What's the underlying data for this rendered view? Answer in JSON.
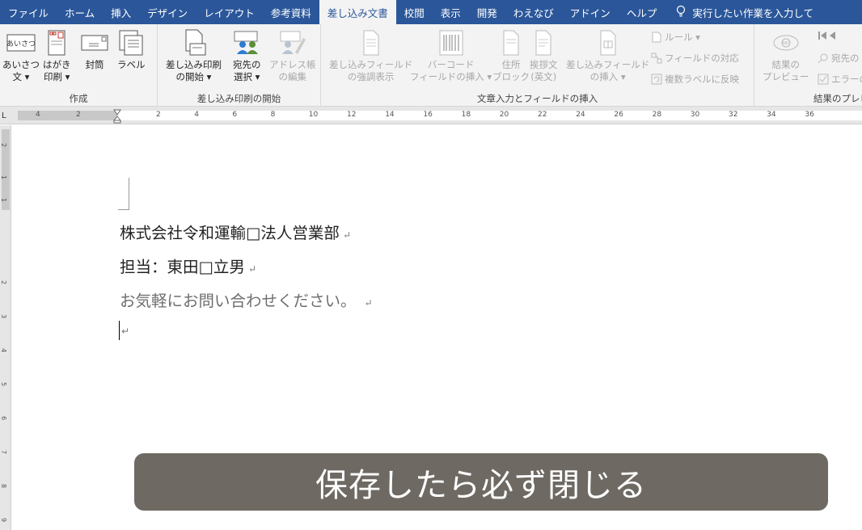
{
  "tabs": [
    {
      "label": "ファイル",
      "active": false
    },
    {
      "label": "ホーム",
      "active": false
    },
    {
      "label": "挿入",
      "active": false
    },
    {
      "label": "デザイン",
      "active": false
    },
    {
      "label": "レイアウト",
      "active": false
    },
    {
      "label": "参考資料",
      "active": false
    },
    {
      "label": "差し込み文書",
      "active": true
    },
    {
      "label": "校閲",
      "active": false
    },
    {
      "label": "表示",
      "active": false
    },
    {
      "label": "開発",
      "active": false
    },
    {
      "label": "わえなび",
      "active": false
    },
    {
      "label": "アドイン",
      "active": false
    },
    {
      "label": "ヘルプ",
      "active": false
    }
  ],
  "tell_me": "実行したい作業を入力して",
  "ribbon": {
    "create": {
      "label": "作成",
      "greeting_line1": "あいさつ",
      "greeting_line2": "文 ▾",
      "postcard_line1": "はがき",
      "postcard_line2": "印刷 ▾",
      "envelope": "封筒",
      "label_btn": "ラベル",
      "greeting_icon_text": "あいさつ"
    },
    "start_merge": {
      "label": "差し込み印刷の開始",
      "start_line1": "差し込み印刷",
      "start_line2": "の開始 ▾",
      "select_line1": "宛先の",
      "select_line2": "選択 ▾",
      "edit_line1": "アドレス帳",
      "edit_line2": "の編集"
    },
    "write_insert": {
      "label": "文章入力とフィールドの挿入",
      "highlight_line1": "差し込みフィールド",
      "highlight_line2": "の強調表示",
      "barcode_line1": "バーコード",
      "barcode_line2": "フィールドの挿入 ▾",
      "address_line1": "住所",
      "address_line2": "ブロック",
      "greeting_en_line1": "挨拶文",
      "greeting_en_line2": "(英文)",
      "insert_field_line1": "差し込みフィールド",
      "insert_field_line2": "の挿入 ▾",
      "rules": "ルール ▾",
      "match_fields": "フィールドの対応",
      "update_labels": "複数ラベルに反映"
    },
    "preview": {
      "label": "結果のプレビュー",
      "preview_line1": "結果の",
      "preview_line2": "プレビュー",
      "find_recipient": "宛先の",
      "check_errors": "エラーの"
    }
  },
  "ruler": {
    "left_numbers": [
      "4",
      "2"
    ],
    "right_numbers": [
      "2",
      "4",
      "6",
      "8",
      "10",
      "12",
      "14",
      "16",
      "18",
      "20",
      "22",
      "24",
      "26",
      "28",
      "30",
      "32",
      "34",
      "36"
    ],
    "vertical_numbers": [
      "2",
      "1",
      "1",
      "2",
      "3",
      "4",
      "5",
      "6",
      "7",
      "8",
      "9"
    ],
    "corner": "L"
  },
  "document": {
    "line1": "株式会社令和運輸□法人営業部",
    "line2": "担当：東田□立男",
    "line3": "お気軽にお問い合わせください。",
    "para_mark": "↵"
  },
  "subtitle": "保存したら必ず閉じる",
  "colors": {
    "ribbon_blue": "#2b579a",
    "subtitle_bg": "#6e6a63"
  }
}
